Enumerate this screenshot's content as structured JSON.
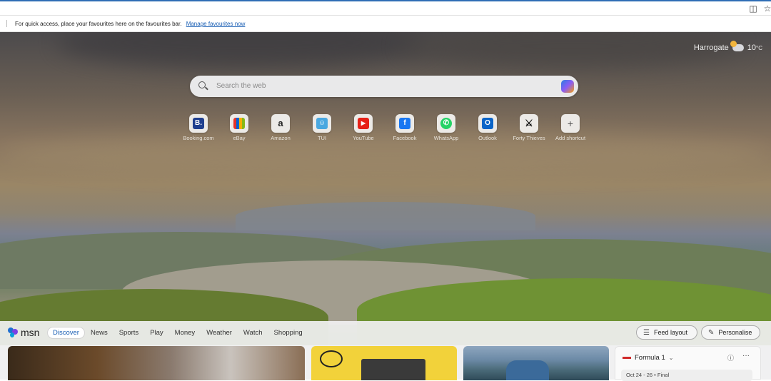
{
  "favourites_bar": {
    "message": "For quick access, place your favourites here on the favourites bar.",
    "link": "Manage favourites now"
  },
  "weather": {
    "location": "Harrogate",
    "temperature": "10",
    "unit": "°C",
    "icon": "partly-cloudy-icon"
  },
  "search": {
    "placeholder": "Search the web"
  },
  "shortcuts": [
    {
      "label": "Booking.com",
      "icon": "booking-icon",
      "glyph": "B.",
      "color": "#1f3f8f"
    },
    {
      "label": "eBay",
      "icon": "ebay-icon",
      "glyph": "▦",
      "color": "#e5332a"
    },
    {
      "label": "Amazon",
      "icon": "amazon-icon",
      "glyph": "a",
      "color": "#222222"
    },
    {
      "label": "TUI",
      "icon": "tui-icon",
      "glyph": "☺",
      "color": "#4aa8e0"
    },
    {
      "label": "YouTube",
      "icon": "youtube-icon",
      "glyph": "▶",
      "color": "#e62117"
    },
    {
      "label": "Facebook",
      "icon": "facebook-icon",
      "glyph": "f",
      "color": "#1877f2"
    },
    {
      "label": "WhatsApp",
      "icon": "whatsapp-icon",
      "glyph": "✆",
      "color": "#25d366"
    },
    {
      "label": "Outlook",
      "icon": "outlook-icon",
      "glyph": "O",
      "color": "#0a64c8"
    },
    {
      "label": "Forty Thieves",
      "icon": "forty-thieves-icon",
      "glyph": "⚔",
      "color": "#111111"
    },
    {
      "label": "Add shortcut",
      "icon": "plus-icon",
      "glyph": "+",
      "color": "#eceae7"
    }
  ],
  "msn": {
    "logo_text": "msn",
    "tabs": [
      "Discover",
      "News",
      "Sports",
      "Play",
      "Money",
      "Weather",
      "Watch",
      "Shopping"
    ],
    "active_tab": "Discover",
    "feed_layout_label": "Feed layout",
    "personalise_label": "Personalise"
  },
  "formula1": {
    "title": "Formula 1",
    "date_line": "Oct 24 - 26 • Final"
  },
  "colors": {
    "accent": "#1a5fb4",
    "edge_blue": "#2f6db5"
  }
}
